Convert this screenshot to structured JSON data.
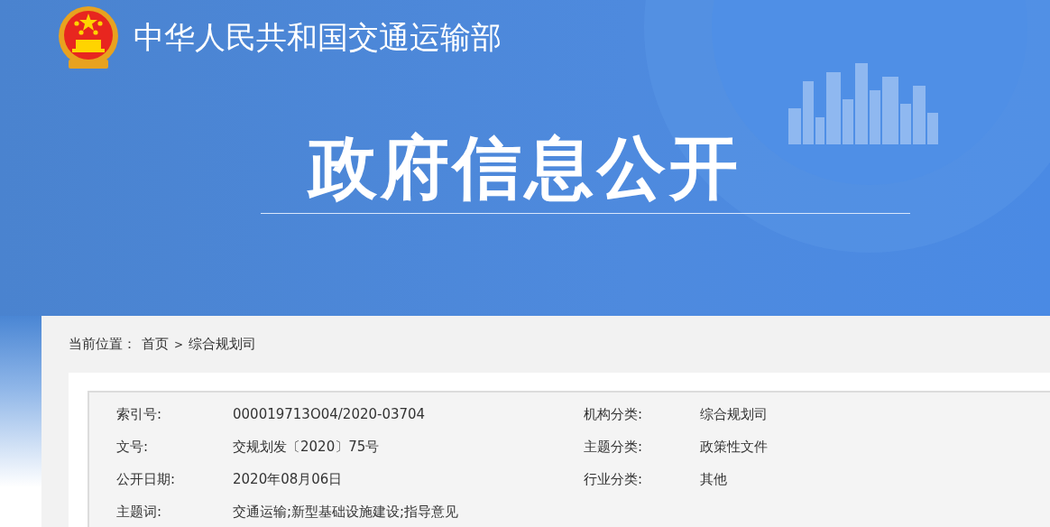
{
  "site": {
    "title": "中华人民共和国交通运输部"
  },
  "banner": {
    "heading": "政府信息公开"
  },
  "breadcrumb": {
    "label": "当前位置：",
    "items": [
      "首页",
      "综合规划司"
    ],
    "separator": ">"
  },
  "info": {
    "rows": [
      {
        "cells": [
          {
            "label": "索引号:",
            "value": "000019713O04/2020-03704"
          },
          {
            "label": "机构分类:",
            "value": "综合规划司"
          }
        ]
      },
      {
        "cells": [
          {
            "label": "文号:",
            "value": "交规划发〔2020〕75号"
          },
          {
            "label": "主题分类:",
            "value": "政策性文件"
          }
        ]
      },
      {
        "cells": [
          {
            "label": "公开日期:",
            "value": "2020年08月06日"
          },
          {
            "label": "行业分类:",
            "value": "其他"
          }
        ]
      },
      {
        "cells": [
          {
            "label": "主题词:",
            "value": "交通运输;新型基础设施建设;指导意见"
          }
        ]
      }
    ]
  }
}
